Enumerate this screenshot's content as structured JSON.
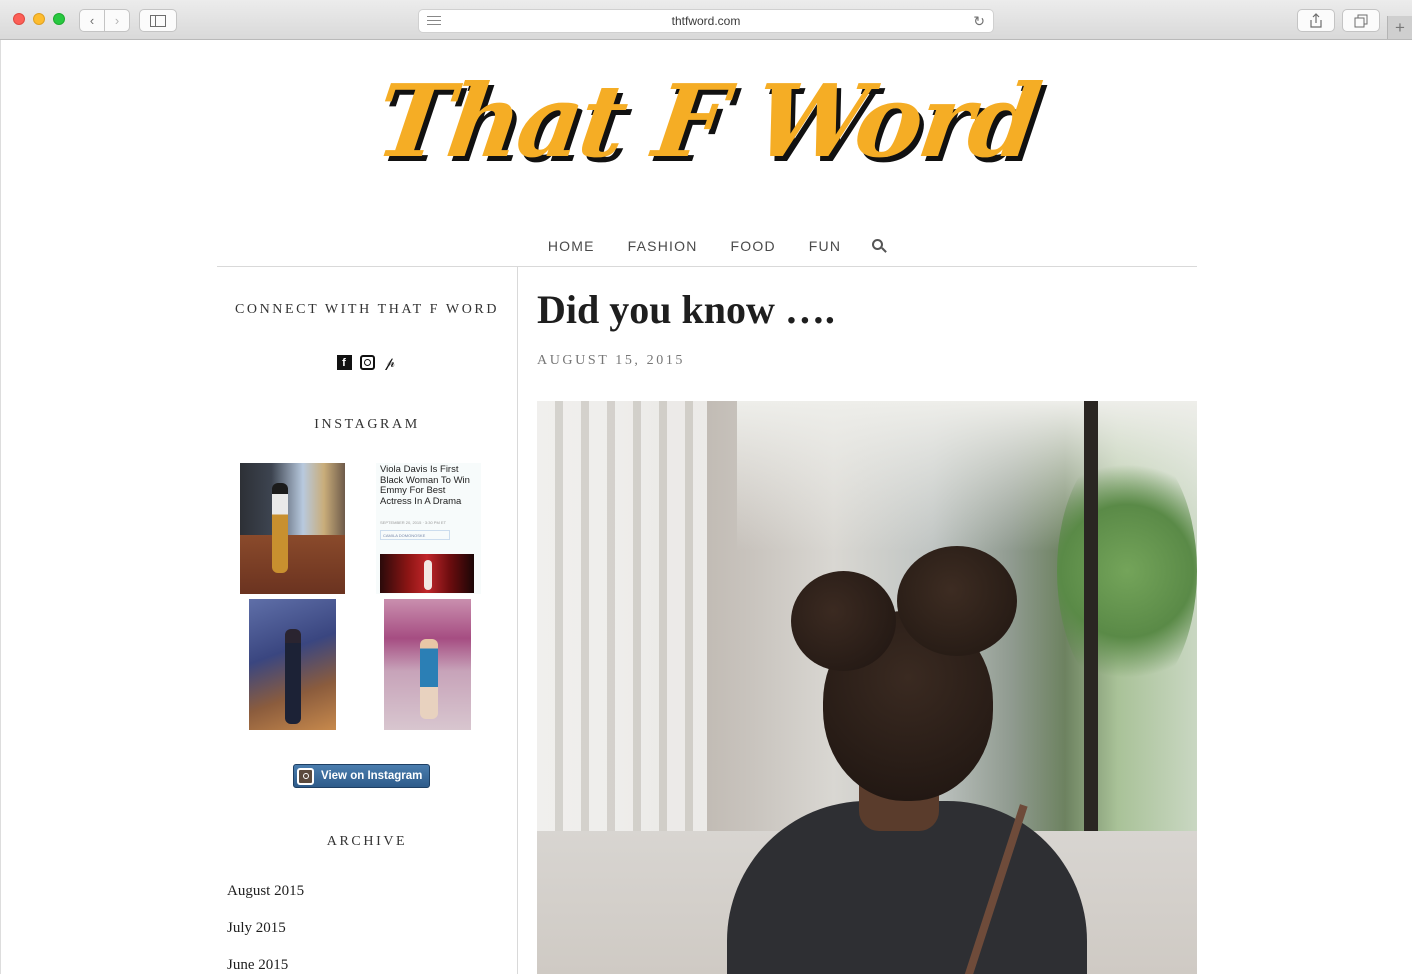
{
  "browser": {
    "url": "thtfword.com",
    "nav_back": "‹",
    "nav_forward": "›",
    "reload": "↻",
    "new_tab": "+"
  },
  "site": {
    "logo": "That F Word",
    "logo_color": "#f5ad25",
    "nav": {
      "items": [
        "HOME",
        "FASHION",
        "FOOD",
        "FUN"
      ]
    }
  },
  "sidebar": {
    "connect_heading": "CONNECT WITH THAT F WORD",
    "social": {
      "facebook": "f",
      "pinterest": "𝓅"
    },
    "instagram_heading": "INSTAGRAM",
    "instagram_post_text": "Viola Davis Is First Black Woman To Win Emmy For Best Actress In A Drama",
    "instagram_post_meta": "SEPTEMBER 20, 2015 · 3:30 PM ET",
    "instagram_post_author": "CAMILA DOMONOSKE",
    "instagram_button": "View on Instagram",
    "archive_heading": "ARCHIVE",
    "archive_items": [
      "August 2015",
      "July 2015",
      "June 2015"
    ]
  },
  "post": {
    "title": "Did you know ….",
    "date": "AUGUST 15, 2015"
  }
}
